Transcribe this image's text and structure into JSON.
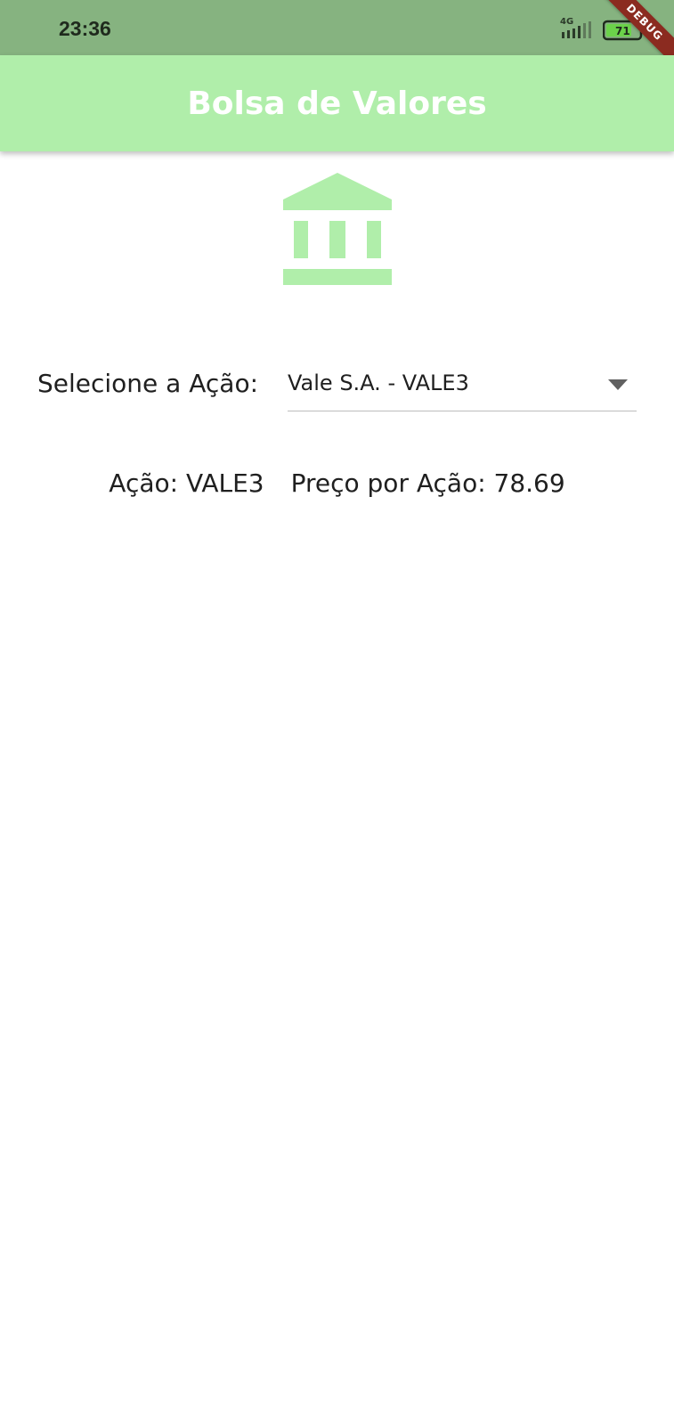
{
  "status_bar": {
    "time": "23:36",
    "network": "4G",
    "battery_level": "71",
    "icons": [
      "signal-icon",
      "battery-icon"
    ]
  },
  "debug_banner": {
    "label": "DEBUG"
  },
  "app_bar": {
    "title": "Bolsa de Valores"
  },
  "hero": {
    "icon": "bank-icon"
  },
  "selector": {
    "label": "Selecione a Ação:",
    "selected_value": "Vale S.A. - VALE3",
    "icon": "arrow-drop-down-icon"
  },
  "result": {
    "stock": "Ação: VALE3",
    "price": "Preço por Ação: 78.69"
  },
  "colors": {
    "status_bar": "#86b380",
    "app_bar": "#b0eeaa",
    "accent": "#b0eeaa",
    "debug_banner": "#8b2b20"
  }
}
